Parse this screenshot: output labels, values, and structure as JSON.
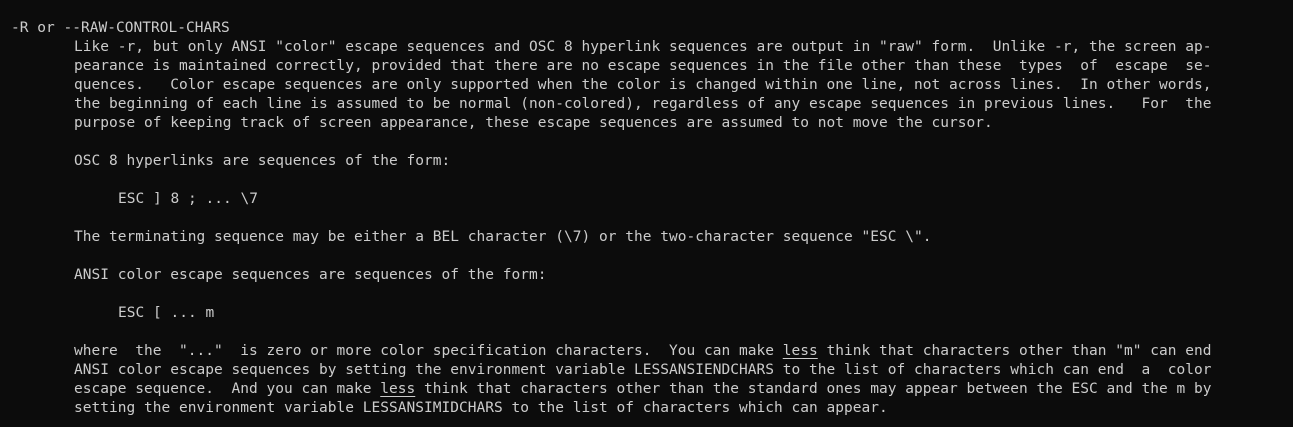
{
  "option_heading": "-R or --RAW-CONTROL-CHARS",
  "para1": [
    "Like -r, but only ANSI \"color\" escape sequences and OSC 8 hyperlink sequences are output in \"raw\" form.  Unlike -r, the screen ap-",
    "pearance is maintained correctly, provided that there are no escape sequences in the file other than these  types  of  escape  se-",
    "quences.   Color escape sequences are only supported when the color is changed within one line, not across lines.  In other words,",
    "the beginning of each line is assumed to be normal (non-colored), regardless of any escape sequences in previous lines.   For  the",
    "purpose of keeping track of screen appearance, these escape sequences are assumed to not move the cursor."
  ],
  "osc_intro": "OSC 8 hyperlinks are sequences of the form:",
  "osc_form": "ESC ] 8 ; ... \\7",
  "terminating": "The terminating sequence may be either a BEL character (\\7) or the two-character sequence \"ESC \\\".",
  "ansi_intro": "ANSI color escape sequences are sequences of the form:",
  "ansi_form": "ESC [ ... m",
  "where_para": {
    "l1_a": "where  the  \"...\"  is zero or more color specification characters.  You can make ",
    "l1_u": "less",
    "l1_b": " think that characters other than \"m\" can end",
    "l2": "ANSI color escape sequences by setting the environment variable LESSANSIENDCHARS to the list of characters which can end  a  color",
    "l3_a": "escape sequence.  And you can make ",
    "l3_u": "less",
    "l3_b": " think that characters other than the standard ones may appear between the ESC and the m by",
    "l4": "setting the environment variable LESSANSIMIDCHARS to the list of characters which can appear."
  }
}
